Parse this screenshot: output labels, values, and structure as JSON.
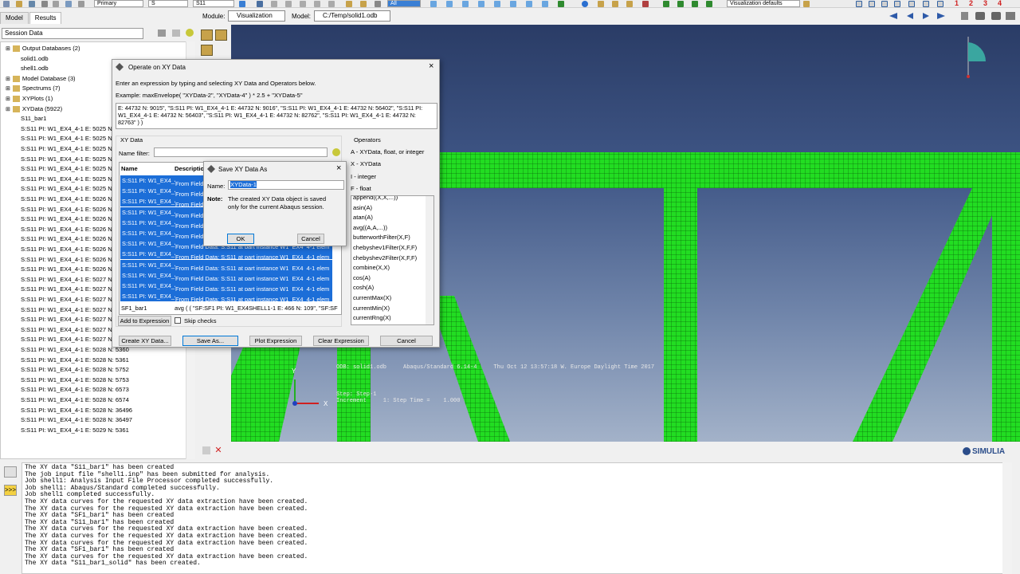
{
  "toolbar": {
    "primary_label": "Primary",
    "variable_label": "S",
    "component_label": "S11",
    "all_label": "All",
    "defaults_label": "Visualization defaults",
    "viewport_numbers": [
      "1",
      "2",
      "3",
      "4"
    ]
  },
  "module_row": {
    "module_label": "Module:",
    "module_value": "Visualization",
    "model_label": "Model:",
    "model_value": "C:/Temp/solid1.odb"
  },
  "tabs": [
    "Model",
    "Results"
  ],
  "session_combo": "Session Data",
  "tree": {
    "items": [
      {
        "text": "Output Databases (2)",
        "indent": 0
      },
      {
        "text": "solid1.odb",
        "indent": 1
      },
      {
        "text": "shell1.odb",
        "indent": 1
      },
      {
        "text": "Model Database (3)",
        "indent": 0
      },
      {
        "text": "Spectrums (7)",
        "indent": 0
      },
      {
        "text": "XYPlots (1)",
        "indent": 0
      },
      {
        "text": "XYData (5922)",
        "indent": 0
      },
      {
        "text": "S11_bar1",
        "indent": 1
      },
      {
        "text": "S:S11 PI: W1_EX4_4-1 E: 5025 N: 5",
        "indent": 1
      },
      {
        "text": "S:S11 PI: W1_EX4_4-1 E: 5025 N: 5",
        "indent": 1
      },
      {
        "text": "S:S11 PI: W1_EX4_4-1 E: 5025 N: 5",
        "indent": 1
      },
      {
        "text": "S:S11 PI: W1_EX4_4-1 E: 5025 N: 5",
        "indent": 1
      },
      {
        "text": "S:S11 PI: W1_EX4_4-1 E: 5025 N: 6",
        "indent": 1
      },
      {
        "text": "S:S11 PI: W1_EX4_4-1 E: 5025 N: 3",
        "indent": 1
      },
      {
        "text": "S:S11 PI: W1_EX4_4-1 E: 5025 N: 3",
        "indent": 1
      },
      {
        "text": "S:S11 PI: W1_EX4_4-1 E: 5026 N: 5",
        "indent": 1
      },
      {
        "text": "S:S11 PI: W1_EX4_4-1 E: 5026 N: 5",
        "indent": 1
      },
      {
        "text": "S:S11 PI: W1_EX4_4-1 E: 5026 N: 5",
        "indent": 1
      },
      {
        "text": "S:S11 PI: W1_EX4_4-1 E: 5026 N: 5",
        "indent": 1
      },
      {
        "text": "S:S11 PI: W1_EX4_4-1 E: 5026 N: 6",
        "indent": 1
      },
      {
        "text": "S:S11 PI: W1_EX4_4-1 E: 5026 N: 6",
        "indent": 1
      },
      {
        "text": "S:S11 PI: W1_EX4_4-1 E: 5026 N: 3",
        "indent": 1
      },
      {
        "text": "S:S11 PI: W1_EX4_4-1 E: 5026 N: 3",
        "indent": 1
      },
      {
        "text": "S:S11 PI: W1_EX4_4-1 E: 5027 N: 5",
        "indent": 1
      },
      {
        "text": "S:S11 PI: W1_EX4_4-1 E: 5027 N: 5",
        "indent": 1
      },
      {
        "text": "S:S11 PI: W1_EX4_4-1 E: 5027 N: 5",
        "indent": 1
      },
      {
        "text": "S:S11 PI: W1_EX4_4-1 E: 5027 N: 6",
        "indent": 1
      },
      {
        "text": "S:S11 PI: W1_EX4_4-1 E: 5027 N: 6",
        "indent": 1
      },
      {
        "text": "S:S11 PI: W1_EX4_4-1 E: 5027 N: 36495",
        "indent": 1
      },
      {
        "text": "S:S11 PI: W1_EX4_4-1 E: 5027 N: 36496",
        "indent": 1
      },
      {
        "text": "S:S11 PI: W1_EX4_4-1 E: 5028 N: 5360",
        "indent": 1
      },
      {
        "text": "S:S11 PI: W1_EX4_4-1 E: 5028 N: 5361",
        "indent": 1
      },
      {
        "text": "S:S11 PI: W1_EX4_4-1 E: 5028 N: 5752",
        "indent": 1
      },
      {
        "text": "S:S11 PI: W1_EX4_4-1 E: 5028 N: 5753",
        "indent": 1
      },
      {
        "text": "S:S11 PI: W1_EX4_4-1 E: 5028 N: 6573",
        "indent": 1
      },
      {
        "text": "S:S11 PI: W1_EX4_4-1 E: 5028 N: 6574",
        "indent": 1
      },
      {
        "text": "S:S11 PI: W1_EX4_4-1 E: 5028 N: 36496",
        "indent": 1
      },
      {
        "text": "S:S11 PI: W1_EX4_4-1 E: 5028 N: 36497",
        "indent": 1
      },
      {
        "text": "S:S11 PI: W1_EX4_4-1 E: 5029 N: 5361",
        "indent": 1
      }
    ]
  },
  "viewport": {
    "odb_line": "ODB: solid1.odb     Abaqus/Standard 6.14-4     Thu Oct 12 13:57:18 W. Europe Daylight Time 2017",
    "step_line": "Step: Step-1",
    "increment_line": "Increment     1: Step Time =    1.000",
    "axis_x": "X",
    "axis_y": "Y",
    "simulia": "SIMULIA",
    "colors": {
      "bg_top": "#2a3c66",
      "mesh": "#22dd22",
      "mesh_lines": "#0b6a0b"
    }
  },
  "operate_dialog": {
    "title": "Operate on XY Data",
    "instruction": "Enter an expression by typing and selecting XY Data and Operators below.",
    "example": "Example: maxEnvelope( \"XYData-2\", \"XYData-4\" ) * 2.5 + \"XYData-5\"",
    "expression": "E: 44732 N: 9015\", \"S:S11 PI: W1_EX4_4-1 E: 44732 N: 9016\", \"S:S11 PI: W1_EX4_4-1 E: 44732 N: 56402\", \"S:S11 PI: W1_EX4_4-1 E: 44732 N: 56403\", \"S:S11 PI: W1_EX4_4-1 E: 44732 N: 82762\", \"S:S11 PI: W1_EX4_4-1 E: 44732 N: 82763\" ) )",
    "xy_data_label": "XY Data",
    "name_filter_label": "Name filter:",
    "name_filter_value": "",
    "col_name": "Name",
    "col_desc": "Descriptio",
    "selected_rows": [
      {
        "name": "S:S11 PI: W1_EX4_4",
        "desc": "From Field"
      },
      {
        "name": "S:S11 PI: W1_EX4_4",
        "desc": "From Field"
      },
      {
        "name": "S:S11 PI: W1_EX4_4",
        "desc": "From Field"
      },
      {
        "name": "S:S11 PI: W1_EX4_4",
        "desc": "From Field"
      },
      {
        "name": "S:S11 PI: W1_EX4_4",
        "desc": "From Field"
      },
      {
        "name": "S:S11 PI: W1_EX4_4",
        "desc": "From Field"
      },
      {
        "name": "S:S11 PI: W1_EX4_4",
        "desc": "From Field Data: S:S11  at part instance W1_EX4_4-1 elem"
      },
      {
        "name": "S:S11 PI: W1_EX4_4",
        "desc": "From Field Data: S:S11  at part instance W1_EX4_4-1 elem"
      },
      {
        "name": "S:S11 PI: W1_EX4_4",
        "desc": "From Field Data: S:S11  at part instance W1_EX4_4-1 elem"
      },
      {
        "name": "S:S11 PI: W1_EX4_4",
        "desc": "From Field Data: S:S11  at part instance W1_EX4_4-1 elem"
      },
      {
        "name": "S:S11 PI: W1_EX4_4",
        "desc": "From Field Data: S:S11  at part instance W1_EX4_4-1 elem"
      },
      {
        "name": "S:S11 PI: W1_EX4_4",
        "desc": "From Field Data: S:S11  at part instance W1_EX4_4-1 elem"
      }
    ],
    "last_row": {
      "name": "SF1_bar1",
      "desc": "avg ( ( \"SF:SF1 PI: W1_EX4SHELL1-1 E: 466 N: 109\", \"SF:SF"
    },
    "add_to_expression": "Add to Expression",
    "skip_checks": "Skip checks",
    "operators_label": "Operators",
    "operator_types": [
      "A - XYData, float, or integer",
      "X - XYData",
      "I - integer",
      "F - float"
    ],
    "operators": [
      "append((X,X,...))",
      "asin(A)",
      "atan(A)",
      "avg((A,A,...))",
      "butterworthFilter(X,F)",
      "chebyshev1Filter(X,F,F)",
      "chebyshev2Filter(X,F,F)",
      "combine(X,X)",
      "cos(A)",
      "cosh(A)",
      "currentMax(X)",
      "currentMin(X)",
      "currentRng(X)"
    ],
    "buttons": {
      "create": "Create XY Data...",
      "save_as": "Save As...",
      "plot": "Plot Expression",
      "clear": "Clear Expression",
      "cancel": "Cancel"
    }
  },
  "save_dialog": {
    "title": "Save XY Data As",
    "name_label": "Name:",
    "name_value": "XYData-1",
    "note_label": "Note:",
    "note_text": "The created XY Data object is saved only for the current Abaqus session.",
    "ok": "OK",
    "cancel": "Cancel"
  },
  "messages": [
    "The XY data \"S11_bar1\" has been created",
    "The job input file \"shell1.inp\" has been submitted for analysis.",
    "Job shell1: Analysis Input File Processor completed successfully.",
    "Job shell1: Abaqus/Standard completed successfully.",
    "Job shell1 completed successfully.",
    "The XY data curves for the requested XY data extraction have been created.",
    "The XY data curves for the requested XY data extraction have been created.",
    "The XY data \"SF1_bar1\" has been created",
    "The XY data \"S11_bar1\" has been created",
    "The XY data curves for the requested XY data extraction have been created.",
    "The XY data curves for the requested XY data extraction have been created.",
    "The XY data curves for the requested XY data extraction have been created.",
    "The XY data \"SF1_bar1\" has been created",
    "The XY data curves for the requested XY data extraction have been created.",
    "The XY data \"S11_bar1_solid\" has been created."
  ]
}
